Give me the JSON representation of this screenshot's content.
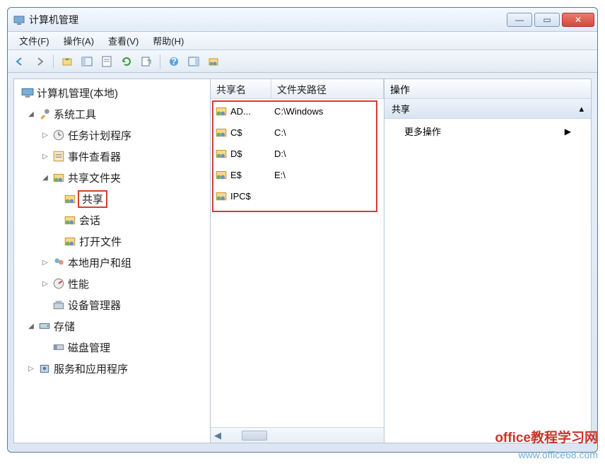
{
  "window": {
    "title": "计算机管理"
  },
  "menu": {
    "file": "文件(F)",
    "action": "操作(A)",
    "view": "查看(V)",
    "help": "帮助(H)"
  },
  "tree": {
    "root": "计算机管理(本地)",
    "systemTools": "系统工具",
    "taskScheduler": "任务计划程序",
    "eventViewer": "事件查看器",
    "sharedFolders": "共享文件夹",
    "shares": "共享",
    "sessions": "会话",
    "openFiles": "打开文件",
    "localUsers": "本地用户和组",
    "performance": "性能",
    "deviceManager": "设备管理器",
    "storage": "存储",
    "diskManagement": "磁盘管理",
    "services": "服务和应用程序"
  },
  "list": {
    "col1": "共享名",
    "col2": "文件夹路径",
    "rows": [
      {
        "name": "AD...",
        "path": "C:\\Windows"
      },
      {
        "name": "C$",
        "path": "C:\\"
      },
      {
        "name": "D$",
        "path": "D:\\"
      },
      {
        "name": "E$",
        "path": "E:\\"
      },
      {
        "name": "IPC$",
        "path": ""
      }
    ]
  },
  "actions": {
    "header": "操作",
    "section": "共享",
    "more": "更多操作"
  },
  "watermark": {
    "line1": "office教程学习网",
    "line2": "www.office68.com"
  }
}
